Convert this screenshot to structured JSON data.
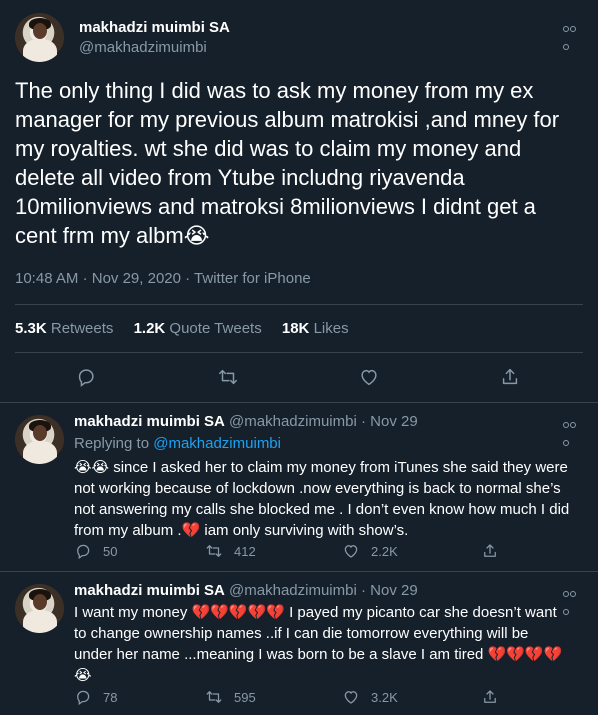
{
  "main_tweet": {
    "author_name": "makhadzi muimbi SA",
    "author_handle": "@makhadzimuimbi",
    "text_lines": [
      "The only thing I did was to ask my money from my ex",
      "manager for my  previous album matrokisi ,and  mney for",
      "my royalties. wt she did was to claim my money and",
      "delete all video from Ytube includng riyavenda",
      "10milionviews and matroksi 8milionviews I didnt get a",
      "cent frm my albm😭"
    ],
    "time": "10:48 AM",
    "date": "Nov 29, 2020",
    "source": "Twitter for iPhone",
    "retweets_count": "5.3K",
    "retweets_label": "Retweets",
    "quotes_count": "1.2K",
    "quotes_label": "Quote Tweets",
    "likes_count": "18K",
    "likes_label": "Likes"
  },
  "replies": [
    {
      "author_name": "makhadzi muimbi SA",
      "author_handle": "@makhadzimuimbi",
      "date": "Nov 29",
      "replying_to_label": "Replying to",
      "replying_to_handle": "@makhadzimuimbi",
      "text_lines": [
        "😭😭 since I asked her to claim my money from iTunes she said they were",
        "not working because of lockdown .now everything is back to normal she’s",
        "not answering my calls she blocked me . I don’t even know how much I did",
        "from my album .💔 iam only surviving with show’s."
      ],
      "reply_count": "50",
      "retweet_count": "412",
      "like_count": "2.2K"
    },
    {
      "author_name": "makhadzi muimbi SA",
      "author_handle": "@makhadzimuimbi",
      "date": "Nov 29",
      "text_lines": [
        "I want my money 💔💔💔💔💔 I payed my picanto car she doesn’t want",
        "to change ownership names ..if I can die tomorrow everything will be",
        "under her name ...meaning I was born to be a slave I am tired 💔💔💔💔",
        "😭"
      ],
      "reply_count": "78",
      "retweet_count": "595",
      "like_count": "3.2K"
    }
  ],
  "icons": [
    "reply-icon",
    "retweet-icon",
    "like-icon",
    "share-icon",
    "more-icon"
  ],
  "colors": {
    "background": "#15202b",
    "text": "#ffffff",
    "muted": "#8899a6",
    "link": "#1da1f2",
    "divider": "#38444d"
  }
}
